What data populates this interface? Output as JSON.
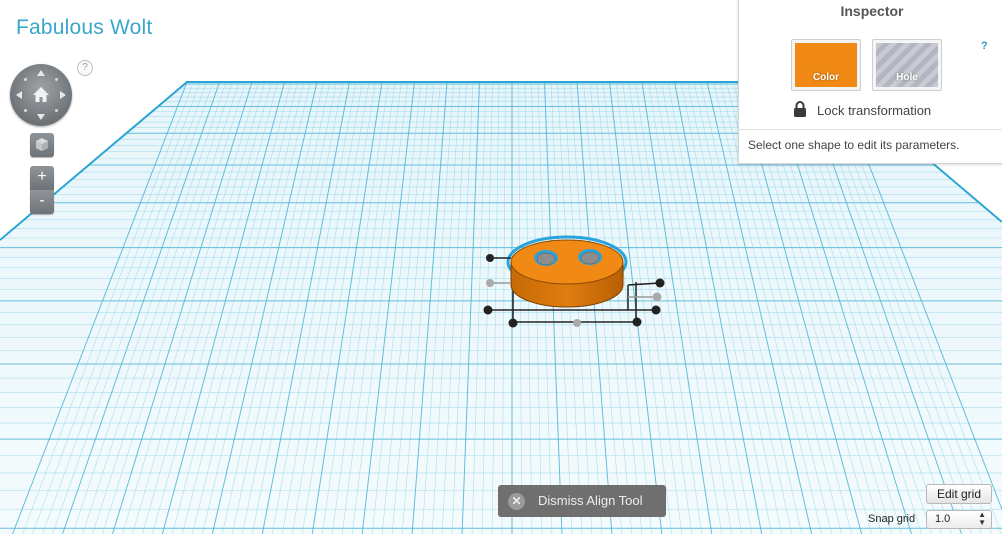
{
  "project": {
    "title": "Fabulous Wolt"
  },
  "view_controls": {
    "help_label": "?",
    "zoom_in_label": "+",
    "zoom_out_label": "-"
  },
  "inspector": {
    "title": "Inspector",
    "help_label": "?",
    "color_label": "Color",
    "hole_label": "Hole",
    "lock_label": "Lock transformation",
    "message": "Select one shape to edit its parameters.",
    "color_value": "#f08a14"
  },
  "align_tool": {
    "dismiss_label": "Dismiss Align Tool"
  },
  "grid": {
    "edit_label": "Edit grid",
    "snap_label": "Snap grid",
    "snap_value": "1.0"
  },
  "colors": {
    "grid_line": "#7ccde4",
    "grid_major": "#4cb4d6",
    "shape_orange": "#f08a14",
    "selection_blue": "#29a3dc",
    "title_blue": "#3aa6c8"
  },
  "icons": [
    "home-icon",
    "cube-icon",
    "lock-icon",
    "close-icon"
  ]
}
